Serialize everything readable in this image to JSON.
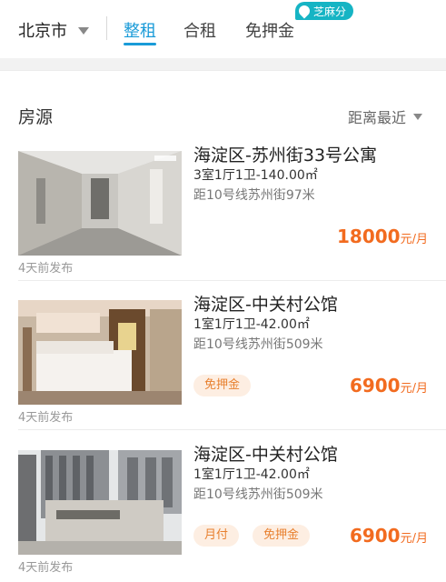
{
  "nav": {
    "city": "北京市",
    "tabs": [
      "整租",
      "合租",
      "免押金"
    ],
    "active_tab": "整租",
    "badge": "芝麻分"
  },
  "list_header": {
    "title": "房源",
    "sort": "距离最近"
  },
  "listings": [
    {
      "title": "海淀区-苏州街33号公寓",
      "spec": "3室1厅1卫-140.00㎡",
      "distance": "距10号线苏州街97米",
      "tags": [],
      "price": "18000",
      "unit": "元/月",
      "posted": "4天前发布"
    },
    {
      "title": "海淀区-中关村公馆",
      "spec": "1室1厅1卫-42.00㎡",
      "distance": "距10号线苏州街509米",
      "tags": [
        "免押金"
      ],
      "price": "6900",
      "unit": "元/月",
      "posted": "4天前发布"
    },
    {
      "title": "海淀区-中关村公馆",
      "spec": "1室1厅1卫-42.00㎡",
      "distance": "距10号线苏州街509米",
      "tags": [
        "月付",
        "免押金"
      ],
      "price": "6900",
      "unit": "元/月",
      "posted": "4天前发布"
    }
  ],
  "colors": {
    "accent": "#1a9bd8",
    "price": "#f26b1f",
    "badge": "#16b4c4",
    "tag_bg": "#fdeee2"
  }
}
